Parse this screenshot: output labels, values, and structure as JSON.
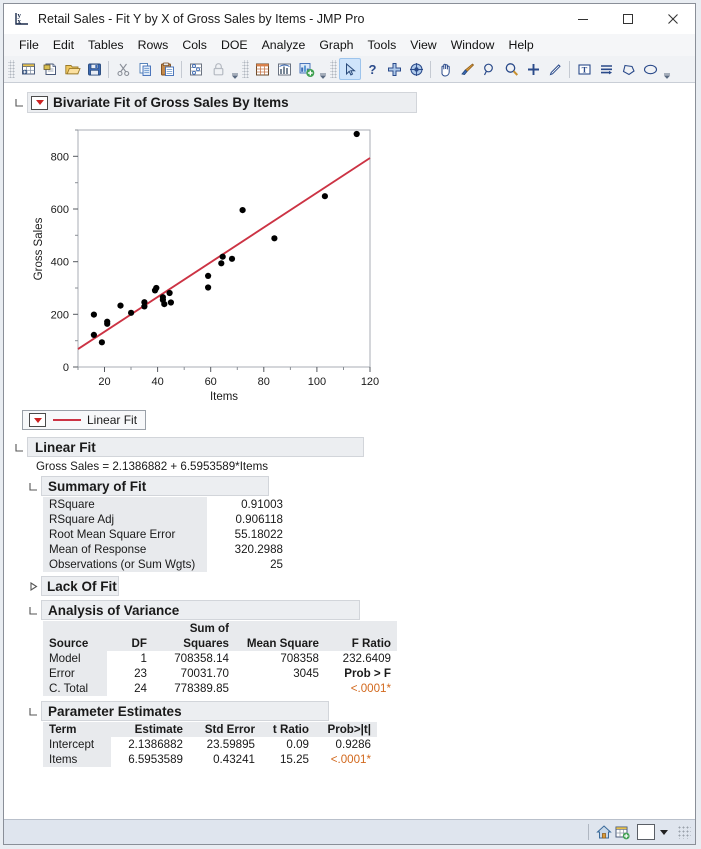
{
  "window": {
    "title": "Retail Sales - Fit Y by X of Gross Sales by Items - JMP Pro",
    "app_icon": "jmp-yx-icon",
    "minimize_label": "–",
    "maximize_label": "□",
    "close_label": "✕"
  },
  "menubar": {
    "items": [
      "File",
      "Edit",
      "Tables",
      "Rows",
      "Cols",
      "DOE",
      "Analyze",
      "Graph",
      "Tools",
      "View",
      "Window",
      "Help"
    ]
  },
  "toolbar": {
    "groups": [
      [
        "new-data-table-icon",
        "new-script-icon",
        "open-file-icon",
        "save-icon",
        "sep",
        "cut-icon",
        "copy-icon",
        "paste-icon",
        "sep",
        "data-filter-icon",
        "lock-icon",
        "overflow"
      ],
      [
        "report-table-icon",
        "distribution-icon",
        "add-graph-icon",
        "overflow"
      ],
      [
        "arrow-select-icon",
        "question-icon",
        "crosshair-icon",
        "brush-target-icon",
        "sep",
        "hand-icon",
        "brush-icon",
        "magnifier-small-icon",
        "magnifier-icon",
        "crosshairs-plus-icon",
        "line-tool-icon",
        "sep",
        "text-annotate-icon",
        "lines-icon",
        "polygon-icon",
        "ellipse-icon",
        "overflow"
      ]
    ]
  },
  "report": {
    "bivariate": {
      "title": "Bivariate Fit of Gross Sales By Items",
      "red_triangle": "red-triangle-menu"
    },
    "legend": {
      "label": "Linear Fit",
      "line_color": "#cc3344"
    },
    "linear_fit": {
      "title": "Linear Fit",
      "equation": "Gross Sales = 2.1386882 + 6.5953589*Items"
    },
    "summary_of_fit": {
      "title": "Summary of Fit",
      "rows": [
        {
          "label": "RSquare",
          "value": "0.91003"
        },
        {
          "label": "RSquare Adj",
          "value": "0.906118"
        },
        {
          "label": "Root Mean Square Error",
          "value": "55.18022"
        },
        {
          "label": "Mean of Response",
          "value": "320.2988"
        },
        {
          "label": "Observations (or Sum Wgts)",
          "value": "25"
        }
      ]
    },
    "lack_of_fit": {
      "title": "Lack Of Fit",
      "collapsed": true
    },
    "anova": {
      "title": "Analysis of Variance",
      "headers": [
        "Source",
        "DF",
        "Sum of Squares",
        "Mean Square",
        "F Ratio"
      ],
      "header_line1": [
        "",
        "",
        "Sum of",
        "",
        ""
      ],
      "header_line2": [
        "Source",
        "DF",
        "Squares",
        "Mean Square",
        "F Ratio"
      ],
      "rows": [
        {
          "source": "Model",
          "df": "1",
          "ss": "708358.14",
          "ms": "708358",
          "f": "232.6409"
        },
        {
          "source": "Error",
          "df": "23",
          "ss": "70031.70",
          "ms": "3045",
          "f": "Prob > F"
        },
        {
          "source": "C. Total",
          "df": "24",
          "ss": "778389.85",
          "ms": "",
          "f": "<.0001*"
        }
      ]
    },
    "parameter_estimates": {
      "title": "Parameter Estimates",
      "headers": [
        "Term",
        "Estimate",
        "Std Error",
        "t Ratio",
        "Prob>|t|"
      ],
      "rows": [
        {
          "term": "Intercept",
          "estimate": "2.1386882",
          "std_error": "23.59895",
          "t_ratio": "0.09",
          "prob": "0.9286"
        },
        {
          "term": "Items",
          "estimate": "6.5953589",
          "std_error": "0.43241",
          "t_ratio": "15.25",
          "prob": "<.0001*"
        }
      ]
    }
  },
  "statusbar": {
    "home_icon": "home-icon",
    "table_icon": "data-table-icon",
    "color_swatch": "#ffffff",
    "caret": "▼"
  },
  "chart_data": {
    "type": "scatter",
    "title": "Bivariate Fit of Gross Sales By Items",
    "xlabel": "Items",
    "ylabel": "Gross Sales",
    "xlim": [
      10,
      120
    ],
    "ylim": [
      0,
      900
    ],
    "xticks": [
      20,
      40,
      60,
      80,
      100,
      120
    ],
    "yticks": [
      0,
      200,
      400,
      600,
      800
    ],
    "x_minor_ticks": [
      10,
      30,
      50,
      70,
      90,
      110
    ],
    "y_minor_ticks": [
      100,
      300,
      500,
      700,
      900
    ],
    "grid": false,
    "legend": "Linear Fit",
    "marker_color": "#000000",
    "point_count": 25,
    "points": [
      {
        "x": 16,
        "y": 199
      },
      {
        "x": 16,
        "y": 122
      },
      {
        "x": 19,
        "y": 94
      },
      {
        "x": 21,
        "y": 172
      },
      {
        "x": 21,
        "y": 164
      },
      {
        "x": 26,
        "y": 233
      },
      {
        "x": 30,
        "y": 206
      },
      {
        "x": 35,
        "y": 246
      },
      {
        "x": 35,
        "y": 230
      },
      {
        "x": 39,
        "y": 291
      },
      {
        "x": 39.5,
        "y": 300
      },
      {
        "x": 42,
        "y": 265
      },
      {
        "x": 42,
        "y": 255
      },
      {
        "x": 42.5,
        "y": 239
      },
      {
        "x": 44.5,
        "y": 281
      },
      {
        "x": 45,
        "y": 245
      },
      {
        "x": 59,
        "y": 346
      },
      {
        "x": 59,
        "y": 302
      },
      {
        "x": 64,
        "y": 394
      },
      {
        "x": 64.5,
        "y": 419
      },
      {
        "x": 68,
        "y": 411
      },
      {
        "x": 72,
        "y": 596
      },
      {
        "x": 84,
        "y": 489
      },
      {
        "x": 103,
        "y": 649
      },
      {
        "x": 115,
        "y": 885
      }
    ],
    "fit_line": {
      "name": "Linear Fit",
      "color": "#cc3344",
      "intercept": 2.1386882,
      "slope": 6.5953589,
      "equation": "Gross Sales = 2.1386882 + 6.5953589*Items",
      "x_start": 10,
      "x_end": 120
    },
    "statistics": {
      "rsquare": 0.91003,
      "rsquare_adj": 0.906118,
      "rmse": 55.18022,
      "mean_of_response": 320.2988,
      "observations": 25
    }
  }
}
